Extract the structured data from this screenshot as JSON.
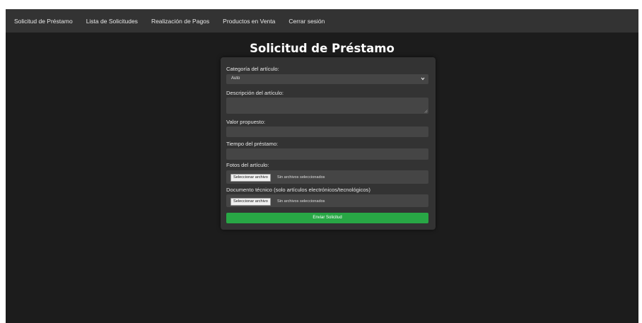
{
  "navbar": {
    "items": [
      {
        "label": "Solicitud de Préstamo"
      },
      {
        "label": "Lista de Solicitudes"
      },
      {
        "label": "Realización de Pagos"
      },
      {
        "label": "Productos en Venta"
      },
      {
        "label": "Cerrar sesión"
      }
    ]
  },
  "page": {
    "title": "Solicitud de Préstamo"
  },
  "form": {
    "category": {
      "label": "Categoría del artículo:",
      "selected": "Auto",
      "icon": "chevron-down-icon"
    },
    "description": {
      "label": "Descripción del artículo:",
      "value": ""
    },
    "value": {
      "label": "Valor propuesto:",
      "value": ""
    },
    "term": {
      "label": "Tiempo del préstamo:",
      "value": ""
    },
    "photos": {
      "label": "Fotos del artículo:",
      "button": "Seleccionar archivo",
      "status": "Sin archivos seleccionados"
    },
    "document": {
      "label": "Documento técnico (solo artículos electrónicos/tecnológicos)",
      "button": "Seleccionar archivo",
      "status": "Sin archivos seleccionados"
    },
    "submit": "Enviar Solicitud"
  },
  "colors": {
    "background": "#1c1c1c",
    "navbar": "#333333",
    "card": "#333333",
    "field": "#454545",
    "accent": "#28a745"
  }
}
